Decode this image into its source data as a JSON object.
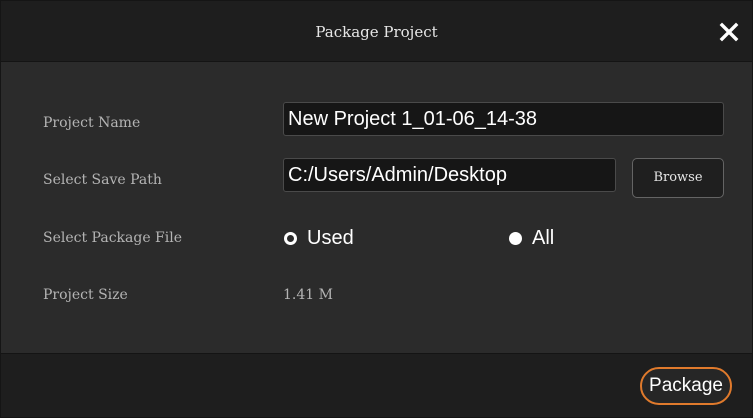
{
  "dialog": {
    "title": "Package Project"
  },
  "form": {
    "project_name": {
      "label": "Project Name",
      "value": "New Project 1_01-06_14-38"
    },
    "save_path": {
      "label": "Select Save Path",
      "value": "C:/Users/Admin/Desktop",
      "browse_label": "Browse"
    },
    "package_file": {
      "label": "Select Package File",
      "options": [
        {
          "label": "Used",
          "selected": true
        },
        {
          "label": "All",
          "selected": false
        }
      ]
    },
    "project_size": {
      "label": "Project Size",
      "value": "1.41 M"
    }
  },
  "footer": {
    "package_label": "Package"
  },
  "colors": {
    "accent": "#e07a2c",
    "background": "#2b2b2b",
    "titlebar": "#1e1e1e"
  },
  "icons": {
    "close": "close-icon"
  }
}
